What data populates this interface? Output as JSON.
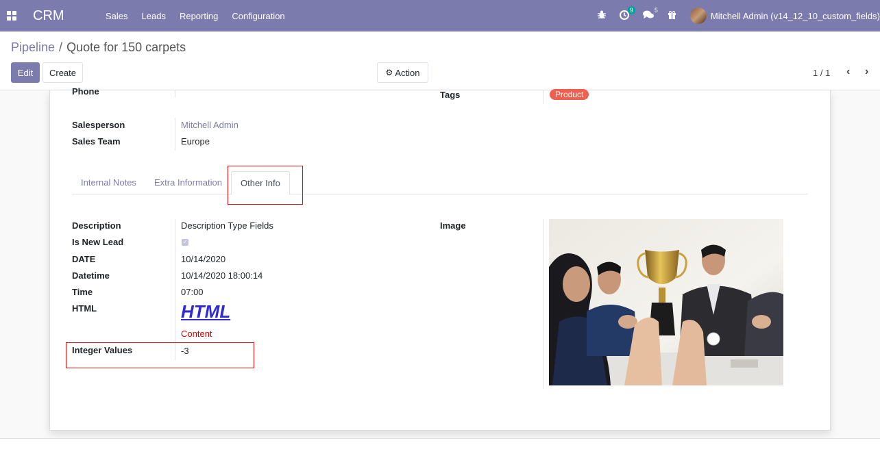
{
  "navbar": {
    "brand": "CRM",
    "menu": [
      "Sales",
      "Leads",
      "Reporting",
      "Configuration"
    ],
    "activity_count": "9",
    "message_count": "5",
    "user": "Mitchell Admin (v14_12_10_custom_fields)"
  },
  "breadcrumb": {
    "parent": "Pipeline",
    "separator": "/",
    "current": "Quote for 150 carpets"
  },
  "buttons": {
    "edit": "Edit",
    "create": "Create",
    "action": "Action"
  },
  "pager": {
    "value": "1 / 1"
  },
  "form": {
    "phone_label": "Phone",
    "tags_label": "Tags",
    "tag_product": "Product",
    "salesperson_label": "Salesperson",
    "salesperson_value": "Mitchell Admin",
    "sales_team_label": "Sales Team",
    "sales_team_value": "Europe"
  },
  "tabs": [
    "Internal Notes",
    "Extra Information",
    "Other Info"
  ],
  "other_info": {
    "description_label": "Description",
    "description_value": "Description Type Fields",
    "is_new_lead_label": "Is New Lead",
    "is_new_lead_checked": true,
    "date_label": "DATE",
    "date_value": "10/14/2020",
    "datetime_label": "Datetime",
    "datetime_value": "10/14/2020 18:00:14",
    "time_label": "Time",
    "time_value": "07:00",
    "html_label": "HTML",
    "html_heading": "HTML",
    "html_content": "Content",
    "integer_label": "Integer Values",
    "integer_value": "-3",
    "image_label": "Image"
  }
}
